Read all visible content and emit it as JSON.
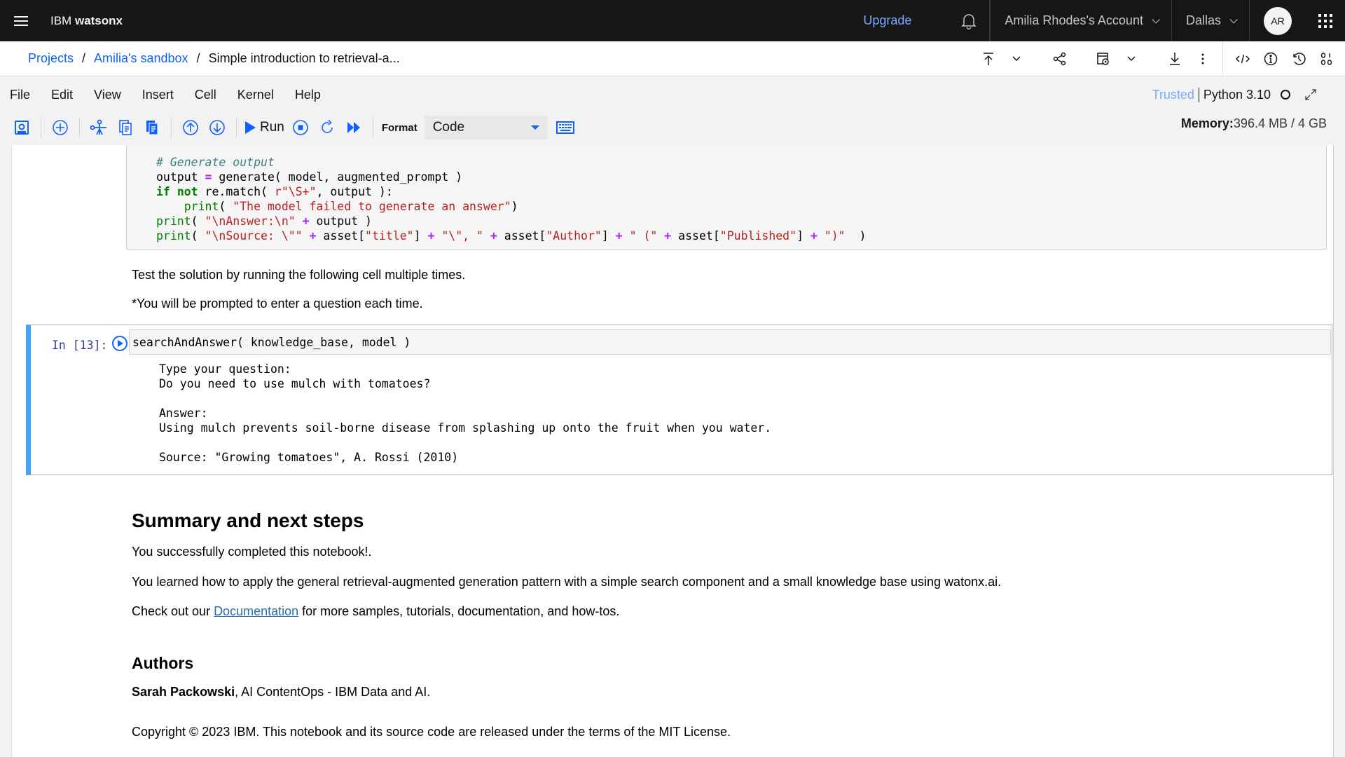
{
  "topbar": {
    "brand_prefix": "IBM",
    "brand_name": "watsonx",
    "upgrade": "Upgrade",
    "account": "Amilia Rhodes's Account",
    "region": "Dallas",
    "avatar_initials": "AR"
  },
  "breadcrumb": {
    "items": [
      "Projects",
      "Amilia's sandbox"
    ],
    "current": "Simple introduction to retrieval-a..."
  },
  "menu": {
    "items": [
      "File",
      "Edit",
      "View",
      "Insert",
      "Cell",
      "Kernel",
      "Help"
    ]
  },
  "kernel": {
    "trusted": "Trusted",
    "name": "Python 3.10"
  },
  "toolbar": {
    "run_label": "Run",
    "format_label": "Format",
    "format_value": "Code"
  },
  "memory": {
    "label": "Memory:",
    "value": "396.4 MB / 4 GB"
  },
  "notebook": {
    "code_lines": [
      "# Generate output",
      "output = generate( model, augmented_prompt )",
      "if not re.match( r\"\\S+\", output ):",
      "    print( \"The model failed to generate an answer\")",
      "print( \"\\nAnswer:\\n\" + output )",
      "print( \"\\nSource: \\\"\" + asset[\"title\"] + \"\\\", \" + asset[\"Author\"] + \" (\" + asset[\"Published\"] + \")\"  )"
    ],
    "md1": "Test the solution by running the following cell multiple times.",
    "md2": "*You will be prompted to enter a question each time.",
    "cell13": {
      "prompt": "In [13]:",
      "input": "searchAndAnswer( knowledge_base, model )",
      "output": "Type your question:\nDo you need to use mulch with tomatoes?\n\nAnswer:\nUsing mulch prevents soil-borne disease from splashing up onto the fruit when you water.\n\nSource: \"Growing tomatoes\", A. Rossi (2010)"
    },
    "summary_heading": "Summary and next steps",
    "summary_p1": "You successfully completed this notebook!.",
    "summary_p2": "You learned how to apply the general retrieval-augmented generation pattern with a simple search component and a small knowledge base using watonx.ai.",
    "summary_p3_before": "Check out our ",
    "summary_p3_link": "Documentation",
    "summary_p3_after": " for more samples, tutorials, documentation, and how-tos.",
    "authors_heading": "Authors",
    "author_name": "Sarah Packowski",
    "author_role": ", AI ContentOps - IBM Data and AI.",
    "copyright": "Copyright © 2023 IBM. This notebook and its source code are released under the terms of the MIT License."
  },
  "colors": {
    "brand_blue": "#0f62fe",
    "upgrade_link": "#78a9ff",
    "topbar_bg": "#161616",
    "selected_cell_bar": "#42a5f5"
  }
}
